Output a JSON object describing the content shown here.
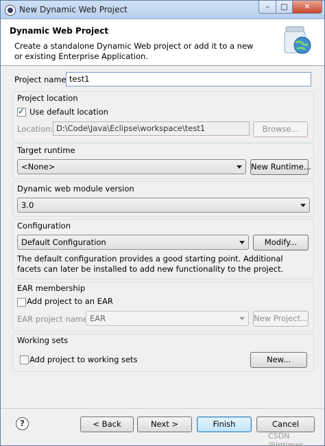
{
  "window": {
    "title": "New Dynamic Web Project",
    "minimize": "–",
    "maximize": "□",
    "close": "✕"
  },
  "header": {
    "title": "Dynamic Web Project",
    "description": "Create a standalone Dynamic Web project or add it to a new or existing Enterprise Application.",
    "icon": "web-project-jar-globe-icon"
  },
  "project_name": {
    "label": "Project name:",
    "value": "test1"
  },
  "project_location": {
    "group_label": "Project location",
    "use_default_label": "Use default location",
    "use_default_checked": true,
    "location_label": "Location:",
    "location_value": "D:\\Code\\Java\\Eclipse\\workspace\\test1",
    "browse_label": "Browse..."
  },
  "target_runtime": {
    "group_label": "Target runtime",
    "selected": "<None>",
    "new_runtime_label": "New Runtime..."
  },
  "module_version": {
    "group_label": "Dynamic web module version",
    "selected": "3.0"
  },
  "configuration": {
    "group_label": "Configuration",
    "selected": "Default Configuration",
    "modify_label": "Modify...",
    "description": "The default configuration provides a good starting point. Additional facets can later be installed to add new functionality to the project."
  },
  "ear": {
    "group_label": "EAR membership",
    "add_label": "Add project to an EAR",
    "add_checked": false,
    "project_name_label": "EAR project name:",
    "project_name_value": "EAR",
    "new_project_label": "New Project..."
  },
  "working_sets": {
    "group_label": "Working sets",
    "add_label": "Add project to working sets",
    "add_checked": false,
    "new_label": "New..."
  },
  "footer": {
    "help_symbol": "?",
    "back_label": "< Back",
    "next_label": "Next >",
    "finish_label": "Finish",
    "cancel_label": "Cancel"
  },
  "watermark": "CSDN @Intimes"
}
